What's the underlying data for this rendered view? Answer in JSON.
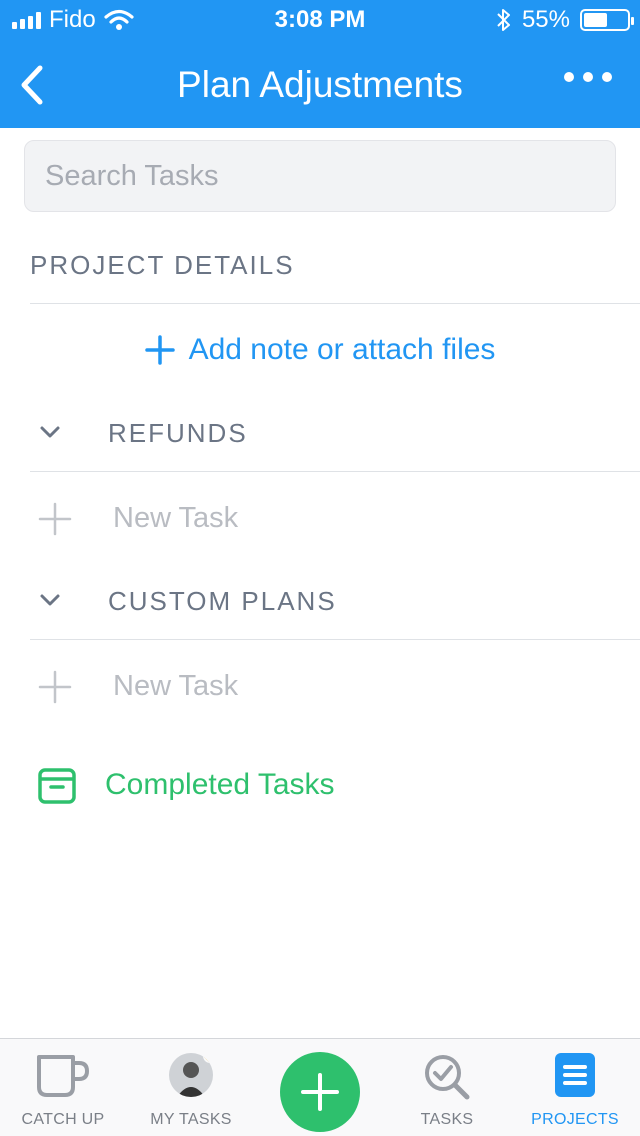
{
  "status_bar": {
    "carrier": "Fido",
    "time": "3:08 PM",
    "battery_percent": "55%",
    "battery_level": 0.55
  },
  "navbar": {
    "title": "Plan Adjustments"
  },
  "search": {
    "placeholder": "Search Tasks",
    "value": ""
  },
  "project_details": {
    "label": "PROJECT DETAILS",
    "add_note_label": "Add note or attach files"
  },
  "groups": [
    {
      "label": "REFUNDS",
      "new_task_label": "New Task"
    },
    {
      "label": "CUSTOM PLANS",
      "new_task_label": "New Task"
    }
  ],
  "completed": {
    "label": "Completed Tasks"
  },
  "tabbar": {
    "tabs": [
      {
        "label": "CATCH UP",
        "icon": "cup-icon"
      },
      {
        "label": "MY TASKS",
        "icon": "avatar"
      },
      {
        "label": "TASKS",
        "icon": "search-check-icon"
      },
      {
        "label": "PROJECTS",
        "icon": "projects-icon",
        "active": true
      }
    ]
  },
  "colors": {
    "primary": "#2196f3",
    "success": "#2ec06d",
    "muted": "#6b7585"
  }
}
